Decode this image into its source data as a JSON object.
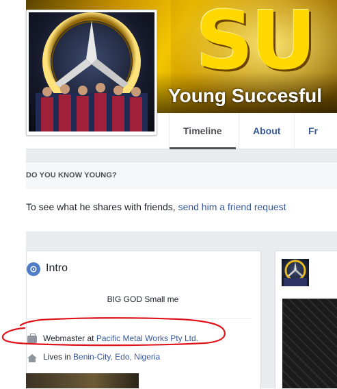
{
  "profile": {
    "name": "Young Succesful",
    "cover_letters": "SU"
  },
  "tabs": [
    {
      "label": "Timeline"
    },
    {
      "label": "About"
    },
    {
      "label": "Fr"
    }
  ],
  "know_section": {
    "title": "DO YOU KNOW YOUNG?",
    "text": "To see what he shares with friends, ",
    "link": "send him a friend request"
  },
  "intro": {
    "title": "Intro",
    "icon": "globe-icon",
    "bio": "BIG GOD Small me",
    "work_prefix": "Webmaster at ",
    "work_link": "Pacific Metal Works Pty Ltd.",
    "lives_prefix": "Lives in ",
    "lives_link": "Benin-City, Edo, Nigeria"
  },
  "colors": {
    "link": "#365899",
    "annotation": "#e0131a",
    "background_gray": "#e9ebee"
  }
}
